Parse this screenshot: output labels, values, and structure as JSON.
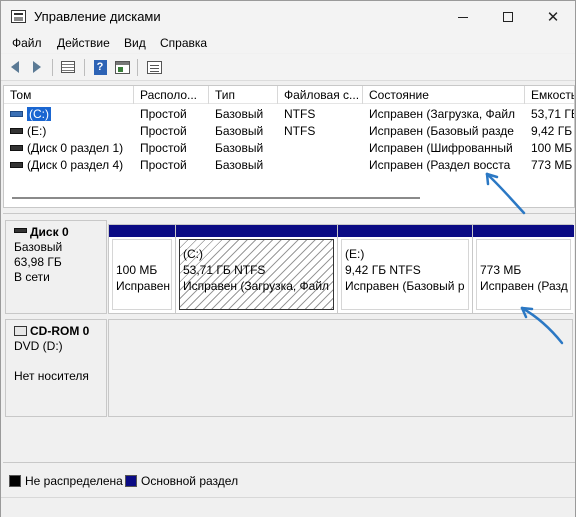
{
  "window": {
    "title": "Управление дисками",
    "min_glyph": "—",
    "max_glyph": "☐",
    "close_glyph": "✕"
  },
  "menu": [
    "Файл",
    "Действие",
    "Вид",
    "Справка"
  ],
  "toolbar": {
    "icons": [
      "back-arrow-icon",
      "forward-arrow-icon",
      "volume-list-icon",
      "help-icon",
      "disk-view-icon",
      "properties-icon"
    ],
    "help_glyph": "?"
  },
  "volumes": {
    "columns": [
      "Том",
      "Располо...",
      "Тип",
      "Файловая с...",
      "Состояние",
      "Емкость"
    ],
    "rows": [
      {
        "name": "(C:)",
        "layout": "Простой",
        "type": "Базовый",
        "fs": "NTFS",
        "status": "Исправен (Загрузка, Файл",
        "capacity": "53,71 ГБ",
        "selected": true
      },
      {
        "name": "(E:)",
        "layout": "Простой",
        "type": "Базовый",
        "fs": "NTFS",
        "status": "Исправен (Базовый разде",
        "capacity": "9,42 ГБ",
        "selected": false
      },
      {
        "name": "(Диск 0 раздел 1)",
        "layout": "Простой",
        "type": "Базовый",
        "fs": "",
        "status": "Исправен (Шифрованный",
        "capacity": "100 МБ",
        "selected": false
      },
      {
        "name": "(Диск 0 раздел 4)",
        "layout": "Простой",
        "type": "Базовый",
        "fs": "",
        "status": "Исправен (Раздел восста",
        "capacity": "773 МБ",
        "selected": false
      }
    ]
  },
  "disks": [
    {
      "name": "Диск 0",
      "kind": "Базовый",
      "size": "63,98 ГБ",
      "state": "В сети",
      "partitions": [
        {
          "title": "",
          "size": "100 МБ",
          "status": "Исправен (Шиф"
        },
        {
          "title": "(C:)",
          "size": "53,71 ГБ NTFS",
          "status": "Исправен (Загрузка, Файл"
        },
        {
          "title": "(E:)",
          "size": "9,42 ГБ NTFS",
          "status": "Исправен (Базовый р"
        },
        {
          "title": "",
          "size": "773 МБ",
          "status": "Исправен (Разд"
        }
      ]
    },
    {
      "name": "CD-ROM 0",
      "kind": "DVD (D:)",
      "state": "Нет носителя"
    }
  ],
  "legend": [
    {
      "label": "Не распределена",
      "color": "#000000"
    },
    {
      "label": "Основной раздел",
      "color": "#0b0b84"
    }
  ],
  "colors": {
    "accent": "#1a66d1",
    "partition_bar": "#0b0b84",
    "callout": "#2b78c4"
  }
}
